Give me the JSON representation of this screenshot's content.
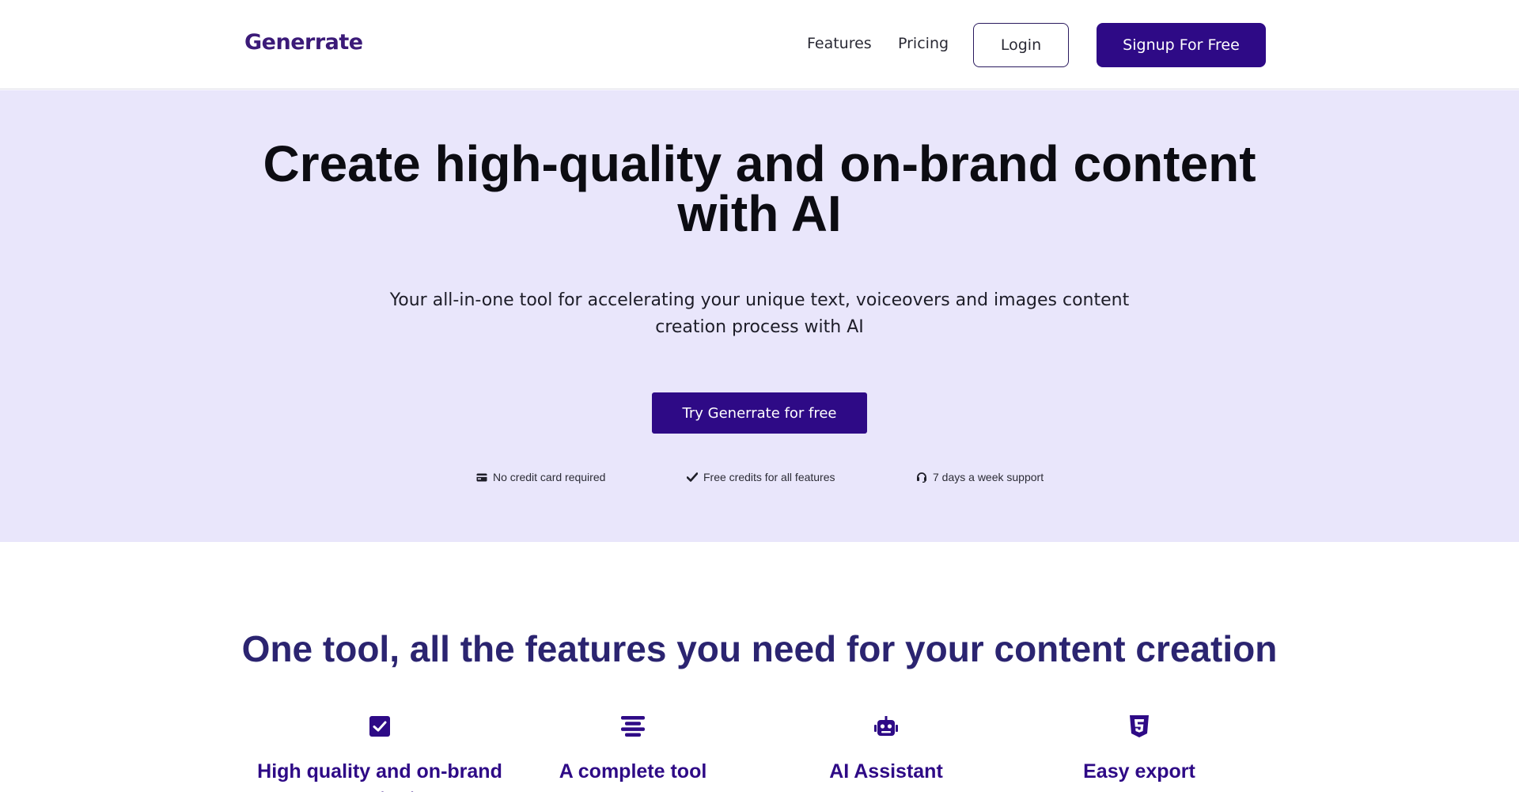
{
  "brand": {
    "name": "Generrate",
    "primary_color": "#2e0a86",
    "hero_background": "#e9e6fb"
  },
  "nav": {
    "features_label": "Features",
    "pricing_label": "Pricing",
    "login_label": "Login",
    "signup_label": "Signup For Free"
  },
  "hero": {
    "title": "Create high-quality and on-brand content with AI",
    "subtitle": "Your all-in-one tool for accelerating your unique text, voiceovers and images content creation process with AI",
    "cta_label": "Try Generrate for free",
    "perks": [
      {
        "icon": "credit-card-icon",
        "label": "No credit card required"
      },
      {
        "icon": "check-icon",
        "label": "Free credits for all features"
      },
      {
        "icon": "headset-icon",
        "label": "7 days a week support"
      }
    ]
  },
  "features": {
    "title": "One tool, all the features you need for your content creation",
    "items": [
      {
        "icon": "checkbox-icon",
        "title": "High quality and on-brand content"
      },
      {
        "icon": "list-icon",
        "title": "A complete tool"
      },
      {
        "icon": "robot-icon",
        "title": "AI Assistant"
      },
      {
        "icon": "html5-icon",
        "title": "Easy export"
      }
    ]
  }
}
